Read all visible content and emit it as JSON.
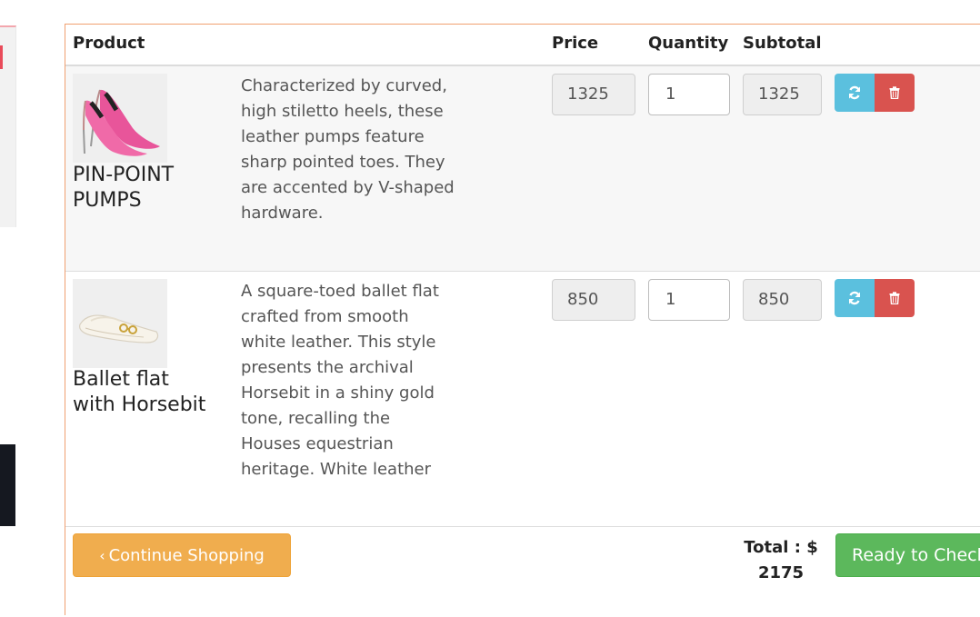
{
  "table": {
    "headers": {
      "product": "Product",
      "price": "Price",
      "quantity": "Quantity",
      "subtotal": "Subtotal"
    }
  },
  "items": [
    {
      "name": "PIN-POINT PUMPS",
      "description": "Characterized by curved, high stiletto heels, these leather pumps feature sharp pointed toes. They are accented by V-shaped hardware.",
      "price": "1325",
      "quantity": "1",
      "subtotal": "1325",
      "image_icon": "pink-stiletto-pumps-image"
    },
    {
      "name": "Ballet flat with Horsebit",
      "description": "A square-toed ballet flat crafted from smooth white leather. This style presents the archival Horsebit in a shiny gold tone, recalling the Houses equestrian heritage. White leather",
      "price": "850",
      "quantity": "1",
      "subtotal": "850",
      "image_icon": "white-ballet-flat-image"
    }
  ],
  "actions": {
    "refresh_icon": "refresh-icon",
    "delete_icon": "trash-icon"
  },
  "footer": {
    "continue_label": "Continue Shopping",
    "total_label": "Total : $",
    "total_value": "2175",
    "checkout_label": "Ready to Checkout"
  },
  "colors": {
    "refresh": "#5bc0de",
    "delete": "#d9534f",
    "continue": "#f0ad4e",
    "checkout": "#5cb85c",
    "border_accent": "#f0a070"
  }
}
